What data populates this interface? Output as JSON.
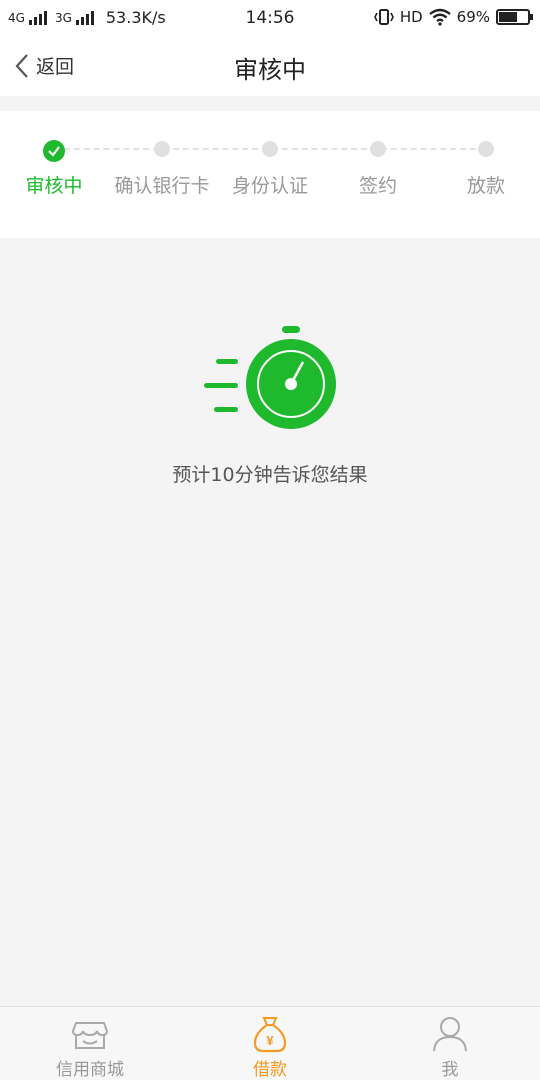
{
  "status_bar": {
    "net1": "4G",
    "net2": "3G",
    "speed": "53.3K/s",
    "time": "14:56",
    "hd": "HD",
    "battery_text": "69%",
    "battery_level": 0.69
  },
  "nav": {
    "back_label": "返回",
    "title": "审核中"
  },
  "steps": [
    {
      "label": "审核中",
      "state": "done"
    },
    {
      "label": "确认银行卡",
      "state": "pending"
    },
    {
      "label": "身份认证",
      "state": "pending"
    },
    {
      "label": "签约",
      "state": "pending"
    },
    {
      "label": "放款",
      "state": "pending"
    }
  ],
  "main": {
    "icon": "stopwatch-icon",
    "hint": "预计10分钟告诉您结果"
  },
  "tabs": [
    {
      "label": "信用商城",
      "icon": "store-icon",
      "active": false
    },
    {
      "label": "借款",
      "icon": "money-bag-icon",
      "active": true
    },
    {
      "label": "我",
      "icon": "user-icon",
      "active": false
    }
  ],
  "colors": {
    "accent_green": "#1fb92e",
    "accent_orange": "#f39a22",
    "inactive": "#999999"
  }
}
